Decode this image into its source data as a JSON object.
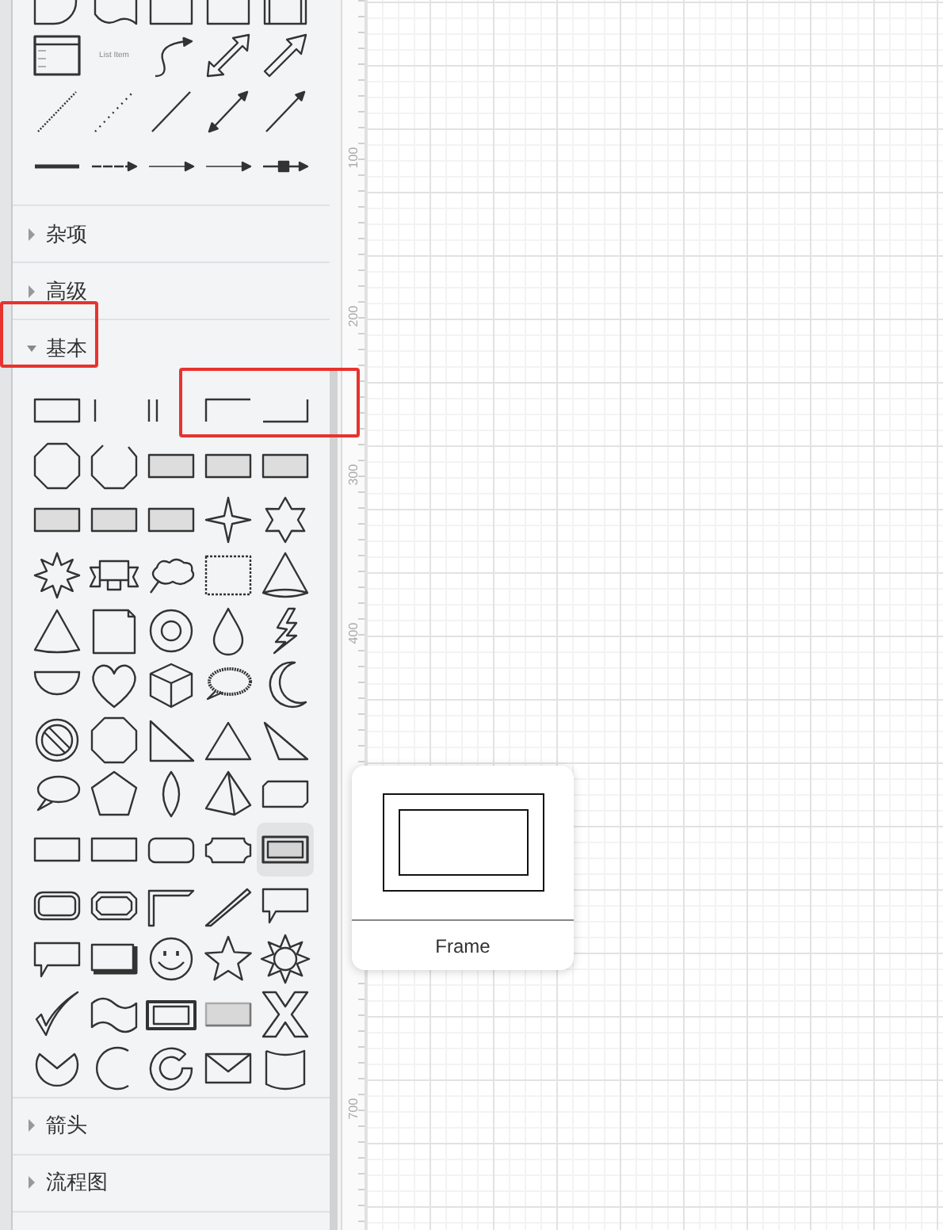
{
  "sidebar": {
    "top_library": {
      "shapes": [
        {
          "kind": "delay"
        },
        {
          "kind": "tape"
        },
        {
          "kind": "rect_tall"
        },
        {
          "kind": "rect_tall"
        },
        {
          "kind": "process"
        },
        {
          "kind": "list"
        },
        {
          "kind": "list_label",
          "label": "List Item"
        },
        {
          "kind": "curve_arrow"
        },
        {
          "kind": "block_double_arrow"
        },
        {
          "kind": "block_arrow"
        },
        {
          "kind": "dotted_line"
        },
        {
          "kind": "sparse_dotted_line"
        },
        {
          "kind": "line"
        },
        {
          "kind": "double_arrow_line"
        },
        {
          "kind": "arrow_line"
        },
        {
          "kind": "thick_line"
        },
        {
          "kind": "connector"
        },
        {
          "kind": "label_connector"
        },
        {
          "kind": "label_connector"
        },
        {
          "kind": "box_connector"
        }
      ]
    },
    "sections": [
      {
        "label": "杂项",
        "expanded": false
      },
      {
        "label": "高级",
        "expanded": false
      },
      {
        "label": "基本",
        "expanded": true,
        "shapes": [
          {
            "kind": "rect",
            "hovered": false
          },
          {
            "kind": "bar_left",
            "hovered": false
          },
          {
            "kind": "double_bar",
            "hovered": false
          },
          {
            "kind": "corner_tl",
            "hovered": false
          },
          {
            "kind": "corner_br",
            "hovered": false
          },
          {
            "kind": "octagon",
            "hovered": false
          },
          {
            "kind": "cut_octagon",
            "hovered": false
          },
          {
            "kind": "gray_rect",
            "hovered": false
          },
          {
            "kind": "gray_rect",
            "hovered": false
          },
          {
            "kind": "gray_rect",
            "hovered": false
          },
          {
            "kind": "gray_rect",
            "hovered": false
          },
          {
            "kind": "gray_rect",
            "hovered": false
          },
          {
            "kind": "gray_rect",
            "hovered": false
          },
          {
            "kind": "star4",
            "hovered": false
          },
          {
            "kind": "star6",
            "hovered": false
          },
          {
            "kind": "burst8",
            "hovered": false
          },
          {
            "kind": "ribbon",
            "hovered": false
          },
          {
            "kind": "cloud",
            "hovered": false
          },
          {
            "kind": "dotted_rect",
            "hovered": false
          },
          {
            "kind": "cone",
            "hovered": false
          },
          {
            "kind": "cone_flat",
            "hovered": false
          },
          {
            "kind": "note",
            "hovered": false
          },
          {
            "kind": "donut",
            "hovered": false
          },
          {
            "kind": "drop",
            "hovered": false
          },
          {
            "kind": "lightning",
            "hovered": false
          },
          {
            "kind": "half_circle",
            "hovered": false
          },
          {
            "kind": "heart",
            "hovered": false
          },
          {
            "kind": "cube",
            "hovered": false
          },
          {
            "kind": "spiky_callout",
            "hovered": false
          },
          {
            "kind": "moon",
            "hovered": false
          },
          {
            "kind": "no_symbol",
            "hovered": false
          },
          {
            "kind": "octagon",
            "hovered": false
          },
          {
            "kind": "right_triangle",
            "hovered": false
          },
          {
            "kind": "triangle",
            "hovered": false
          },
          {
            "kind": "obtuse_triangle",
            "hovered": false
          },
          {
            "kind": "oval_callout",
            "hovered": false
          },
          {
            "kind": "pentagon",
            "hovered": false
          },
          {
            "kind": "lens",
            "hovered": false
          },
          {
            "kind": "pyramid",
            "hovered": false
          },
          {
            "kind": "cut_corner_rect",
            "hovered": false
          },
          {
            "kind": "rect",
            "hovered": false
          },
          {
            "kind": "rect",
            "hovered": false
          },
          {
            "kind": "rounded_rect",
            "hovered": false
          },
          {
            "kind": "plaque",
            "hovered": false
          },
          {
            "kind": "frame",
            "hovered": true
          },
          {
            "kind": "double_rounded",
            "hovered": false
          },
          {
            "kind": "double_plaque",
            "hovered": false
          },
          {
            "kind": "corner_l",
            "hovered": false
          },
          {
            "kind": "diagonal_stripe",
            "hovered": false
          },
          {
            "kind": "callout",
            "hovered": false
          },
          {
            "kind": "callout",
            "hovered": false
          },
          {
            "kind": "shadow_rect",
            "hovered": false
          },
          {
            "kind": "smiley",
            "hovered": false
          },
          {
            "kind": "star5",
            "hovered": false
          },
          {
            "kind": "sun",
            "hovered": false
          },
          {
            "kind": "check",
            "hovered": false
          },
          {
            "kind": "wave",
            "hovered": false
          },
          {
            "kind": "framed_button",
            "hovered": false
          },
          {
            "kind": "gray_button",
            "hovered": false
          },
          {
            "kind": "x_shape",
            "hovered": false
          },
          {
            "kind": "pie_cut",
            "hovered": false
          },
          {
            "kind": "arc",
            "hovered": false
          },
          {
            "kind": "partial_donut",
            "hovered": false
          },
          {
            "kind": "envelope",
            "hovered": false
          },
          {
            "kind": "cylinder_open",
            "hovered": false
          }
        ]
      },
      {
        "label": "箭头",
        "expanded": false
      },
      {
        "label": "流程图",
        "expanded": false
      }
    ]
  },
  "ruler": {
    "labels": [
      "100",
      "200",
      "300",
      "400",
      "700"
    ]
  },
  "tooltip": {
    "label": "Frame"
  }
}
